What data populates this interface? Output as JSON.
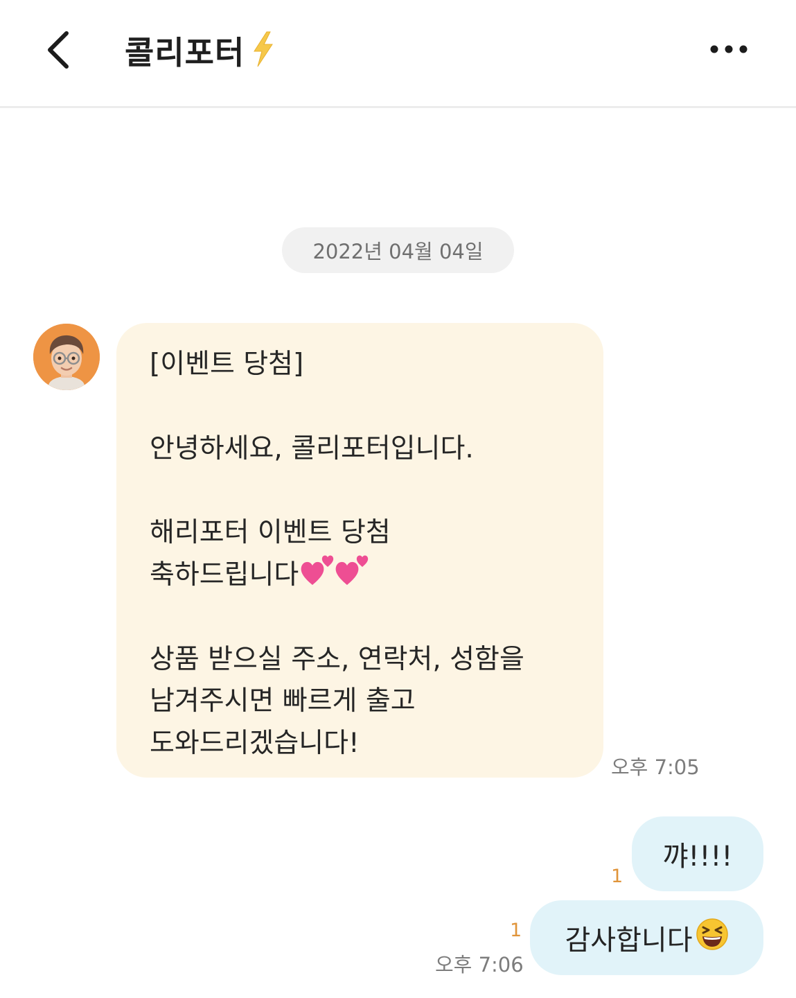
{
  "header": {
    "title": "콜리포터",
    "back_icon": "chevron-left-icon",
    "title_badge_icon": "lightning-bolt-icon",
    "more_icon": "more-horizontal-icon"
  },
  "date_divider": "2022년 04월 04일",
  "incoming": {
    "avatar_icon": "memoji-avatar-icon",
    "lines": [
      "[이벤트 당첨]",
      "",
      "안녕하세요, 콜리포터입니다.",
      "",
      "해리포터 이벤트 당첨",
      "축하드립니다",
      "",
      "상품 받으실 주소, 연락처, 성함을",
      "남겨주시면 빠르게 출고",
      "도와드리겠습니다!"
    ],
    "emoji_after_line_6": "two-hearts-icon",
    "time": "오후 7:05"
  },
  "outgoing": [
    {
      "text": "꺄!!!!",
      "unread": "1"
    },
    {
      "text": "감사합니다",
      "unread": "1",
      "emoji": "laughing-face-icon",
      "time": "오후 7:06"
    }
  ],
  "colors": {
    "incoming_bubble": "#fdf5e4",
    "outgoing_bubble": "#e1f3f9",
    "unread_count": "#e0943a",
    "avatar_bg": "#ee9444",
    "date_pill": "#f1f1f1"
  }
}
